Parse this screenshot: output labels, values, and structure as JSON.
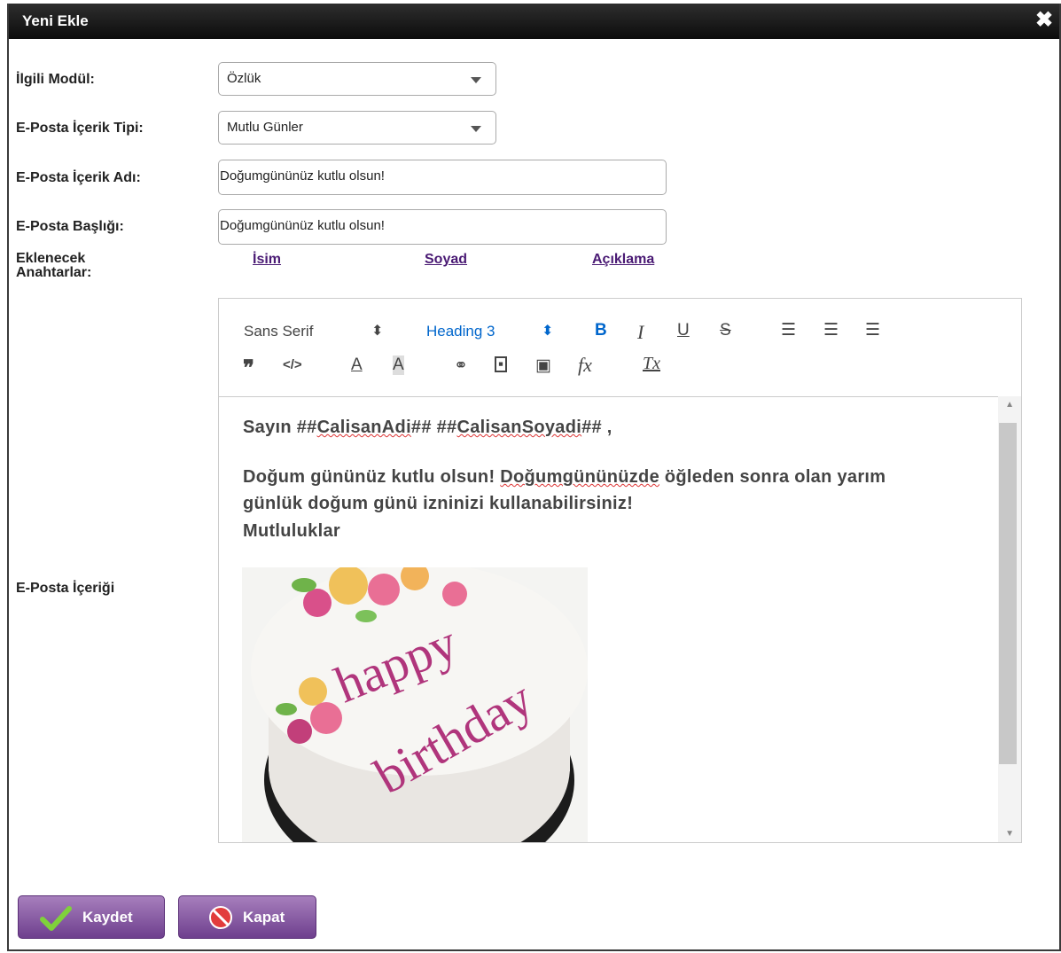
{
  "dialog": {
    "title": "Yeni Ekle",
    "close_icon": "close-icon"
  },
  "form": {
    "module_label": "İlgili Modül:",
    "module_value": "Özlük",
    "content_type_label": "E-Posta İçerik Tipi:",
    "content_type_value": "Mutlu Günler",
    "content_name_label": "E-Posta İçerik Adı:",
    "content_name_value": "Doğumgününüz kutlu olsun!",
    "subject_label": "E-Posta Başlığı:",
    "subject_value": "Doğumgününüz kutlu olsun!",
    "keys_label_line1": "Eklenecek",
    "keys_label_line2": "Anahtarlar:",
    "keys": [
      "İsim",
      "Soyad",
      "Açıklama"
    ],
    "body_label": "E-Posta İçeriği"
  },
  "toolbar": {
    "font": "Sans Serif",
    "heading": "Heading 3",
    "icons": [
      "bold-icon",
      "italic-icon",
      "underline-icon",
      "strike-icon",
      "ordered-list-icon",
      "bullet-list-icon",
      "align-icon",
      "quote-icon",
      "code-icon",
      "text-color-icon",
      "background-color-icon",
      "link-icon",
      "image-icon",
      "video-icon",
      "formula-icon",
      "clear-format-icon"
    ]
  },
  "editor": {
    "line1_a": "Sayın ##",
    "line1_b": "CalisanAdi",
    "line1_c": "##  ##",
    "line1_d": "CalisanSoyadi",
    "line1_e": "## ,",
    "line2_a": "Doğum gününüz kutlu olsun! ",
    "line2_b": "Doğumgününüzde",
    "line2_c": " öğleden sonra olan yarım",
    "line3": "günlük doğum günü izninizi kullanabilirsiniz!",
    "line4": "Mutluluklar",
    "image_text_1": "happy",
    "image_text_2": "birthday"
  },
  "buttons": {
    "save": "Kaydet",
    "close": "Kapat"
  },
  "colors": {
    "accent": "#7b4a9a",
    "title_bar": "#111111",
    "link": "#4a1a74"
  }
}
